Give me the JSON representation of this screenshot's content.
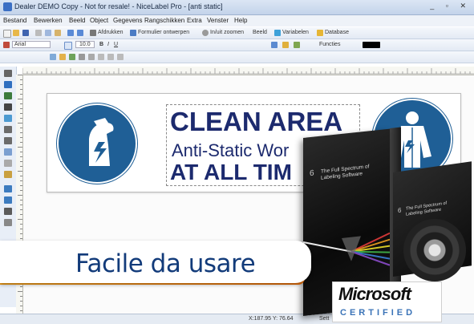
{
  "window": {
    "title": "Dealer DEMO Copy - Not for resale! - NiceLabel Pro - [anti static]",
    "controls": "_ ▫ ✕"
  },
  "menu": [
    "Bestand",
    "Bewerken",
    "Beeld",
    "Object",
    "Gegevens",
    "Rangschikken",
    "Extra",
    "Venster",
    "Help"
  ],
  "toolbar1": {
    "print_label": "Afdrukken",
    "form_label": "Formulier ontwerpen",
    "zoom_label": "In/uit zoomen",
    "view_label": "Beeld",
    "vars_label": "Variabelen",
    "db_label": "Database"
  },
  "toolbar2": {
    "font_value": "Arial",
    "size_value": "10.0",
    "functions_label": "Functies"
  },
  "label_text": {
    "line1": "CLEAN AREA",
    "line2": "Anti-Static Wor",
    "line3": "AT ALL TIM"
  },
  "statusbar": {
    "coords": "X:187.95 Y: 76.64",
    "suffix": "Sett"
  },
  "product_box": {
    "number": "6",
    "title_line1": "The Full Spectrum of",
    "title_line2": "Labeling Software",
    "disc_title_line1": "The Full Spectrum of",
    "disc_title_line2": "Labeling Software"
  },
  "banner": {
    "text": "Facile da usare"
  },
  "badge": {
    "brand": "Microsoft",
    "certification": "CERTIFIED"
  },
  "colors": {
    "sign_blue": "#1f5f96",
    "banner_text": "#123b7a",
    "banner_accent": "#f6a21c",
    "ms_certified": "#3a73b7"
  },
  "icons": [
    "app-icon",
    "new-icon",
    "open-icon",
    "save-icon",
    "print-icon",
    "bold-icon",
    "italic-icon",
    "underline-icon",
    "antistatic-glove-icon",
    "antistatic-coat-icon",
    "pointer-tool-icon",
    "text-tool-icon"
  ]
}
